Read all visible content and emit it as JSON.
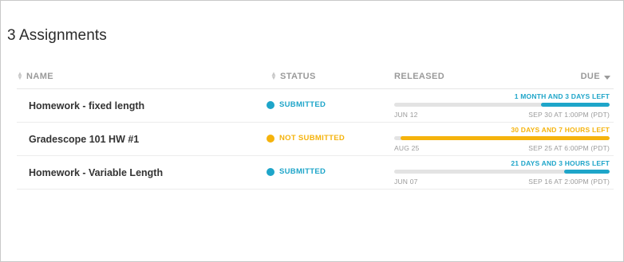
{
  "page": {
    "title": "3 Assignments"
  },
  "table": {
    "headers": {
      "name": "NAME",
      "status": "STATUS",
      "released": "RELEASED",
      "due": "DUE"
    },
    "rows": [
      {
        "name": "Homework - fixed length",
        "status": "SUBMITTED",
        "status_color": "#1ea5c9",
        "time_left": "1 MONTH AND 3 DAYS LEFT",
        "released": "JUN 12",
        "due": "SEP 30 AT 1:00PM (PDT)",
        "progress_start": 0.68,
        "progress_end": 1.0,
        "bar_color": "#1ea5c9"
      },
      {
        "name": "Gradescope 101 HW #1",
        "status": "NOT SUBMITTED",
        "status_color": "#f5b30c",
        "time_left": "30 DAYS AND 7 HOURS LEFT",
        "released": "AUG 25",
        "due": "SEP 25 AT 6:00PM (PDT)",
        "progress_start": 0.03,
        "progress_end": 1.0,
        "bar_color": "#f5b30c"
      },
      {
        "name": "Homework - Variable Length",
        "status": "SUBMITTED",
        "status_color": "#1ea5c9",
        "time_left": "21 DAYS AND 3 HOURS LEFT",
        "released": "JUN 07",
        "due": "SEP 16 AT 2:00PM (PDT)",
        "progress_start": 0.79,
        "progress_end": 1.0,
        "bar_color": "#1ea5c9"
      }
    ]
  }
}
